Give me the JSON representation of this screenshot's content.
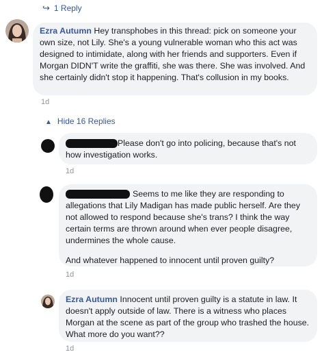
{
  "top_reply": {
    "label": "1 Reply"
  },
  "comment_main": {
    "author": "Ezra Autumn",
    "text": "Hey transphobes in this thread: pick on someone your own size, not Lily. She's a young vulnerable woman who this act was designed to intimidate, along with her friends and supporters. Even if Morgan DIDN'T write the graffiti, she was there. She was involved. And she certainly didn't stop it happening. That's collusion in my books.",
    "time": "1d"
  },
  "hide_replies": {
    "label": "Hide 16 Replies"
  },
  "reply1": {
    "author": "",
    "text": "Please don't go into policing, because that's not how investigation works.",
    "time": "1d"
  },
  "reply2": {
    "author": "",
    "text": "Seems to me like they are responding to allegations that Lily Madigan has made public herself. Are they not allowed to respond because she's trans? I think the way certain terms are thrown around when ever people disagree, undermines the whole cause.",
    "text2": "And whatever happened to innocent until proven guilty?",
    "time": "1d"
  },
  "reply3": {
    "author": "Ezra Autumn",
    "text": "Innocent until proven guilty is a statute in law. It doesn't apply outside of law. There is a witness who places Morgan at the scene as part of the group who trashed the house. What more do you want??",
    "time": "1d"
  },
  "colors": {
    "link": "#385898",
    "bubble": "#f2f3f5",
    "meta": "#90949c"
  }
}
